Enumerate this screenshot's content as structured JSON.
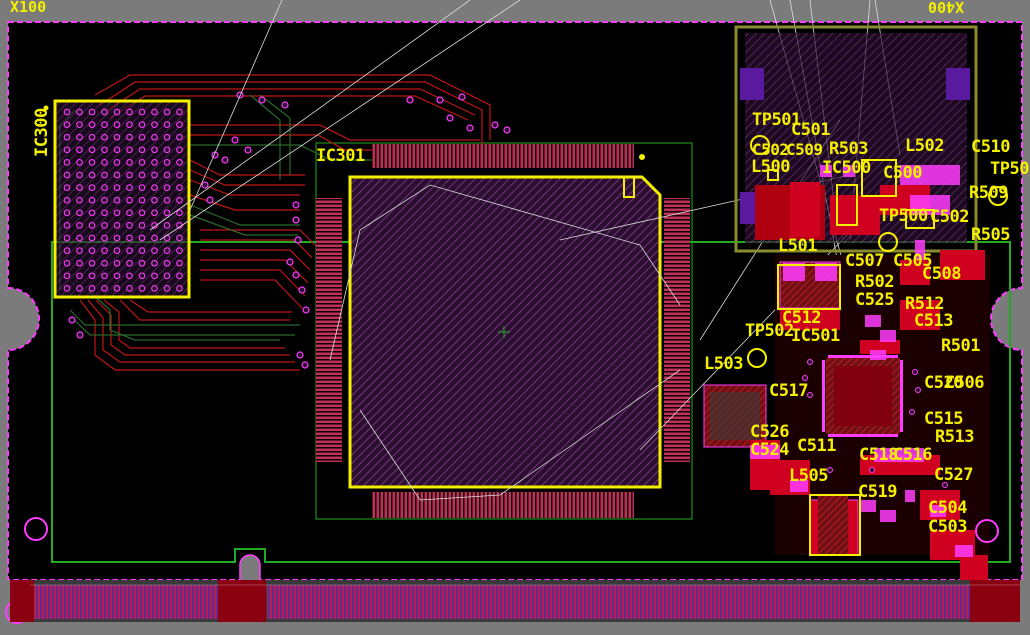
{
  "board": {
    "corner_left": "X100",
    "corner_right": "X400",
    "colors": {
      "background": "#000000",
      "outside": "#7b7b7b",
      "outline": "#ff3cff",
      "silkscreen": "#f5f000",
      "top_copper": "#d40000",
      "bottom_copper": "#205a20",
      "keepout": "#22aa22",
      "pad_magenta": "#ff3cff",
      "hatch_purple": "#7a2a8a"
    }
  },
  "components": {
    "IC300": "IC300",
    "IC301": "IC301",
    "TP501": "TP501",
    "C501": "C501",
    "C502": "C502",
    "C509": "C509",
    "R503": "R503",
    "L502": "L502",
    "C510": "C510",
    "TP50x": "TP50",
    "L500": "L500",
    "IC500": "IC500",
    "C500": "C500",
    "R509": "R509",
    "TP500": "TP500",
    "C502b": "C502",
    "R505": "R505",
    "L501": "L501",
    "C507": "C507",
    "C505": "C505",
    "C508": "C508",
    "R502": "R502",
    "C525": "C525",
    "R512": "R512",
    "C512": "C512",
    "C513": "C513",
    "TP502": "TP502",
    "IC501": "IC501",
    "R501": "R501",
    "L503": "L503",
    "C517": "C517",
    "C520": "C520",
    "C506": "C506",
    "C515": "C515",
    "R513": "R513",
    "C526": "C526",
    "C511": "C511",
    "C524": "C524",
    "C518": "C518",
    "C516": "C516",
    "L505": "L505",
    "C527": "C527",
    "C519": "C519",
    "C504": "C504",
    "C503": "C503"
  }
}
